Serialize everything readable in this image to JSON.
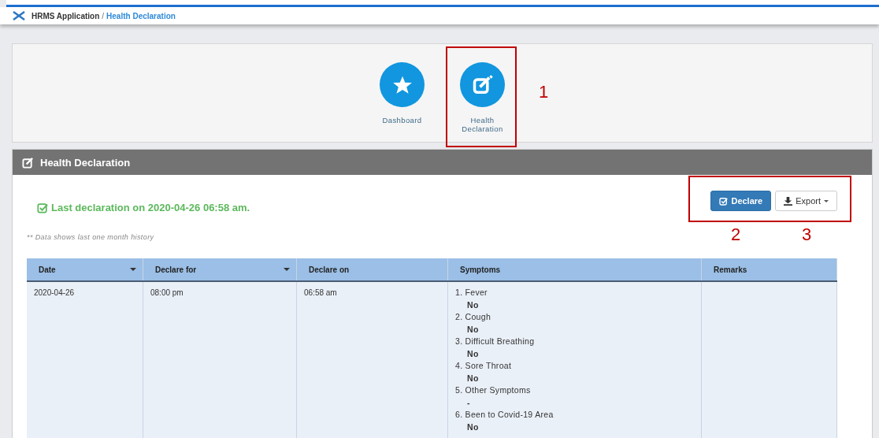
{
  "breadcrumb": {
    "items": [
      "HRMS Application",
      "Health Declaration"
    ],
    "separator": "/"
  },
  "nav": [
    {
      "label": "Dashboard"
    },
    {
      "label": "Health Declaration"
    }
  ],
  "panel": {
    "title": "Health Declaration",
    "status": "Last declaration on 2020-04-26 06:58 am.",
    "buttons": [
      {
        "label": "Declare",
        "kind": "primary"
      },
      {
        "label": "Export",
        "kind": "dropdown"
      }
    ],
    "note": "** Data shows last one month history",
    "table": {
      "columns": [
        {
          "label": "Date",
          "sortable": true
        },
        {
          "label": "Declare for",
          "sortable": true
        },
        {
          "label": "Declare on",
          "sortable": false
        },
        {
          "label": "Symptoms",
          "sortable": false
        },
        {
          "label": "Remarks",
          "sortable": false
        }
      ],
      "rows": [
        {
          "date": "2020-04-26",
          "declare_for": "08:00 pm",
          "declare_on": "06:58 am",
          "symptoms": [
            {
              "question": "1. Fever",
              "answer": "No"
            },
            {
              "question": "2. Cough",
              "answer": "No"
            },
            {
              "question": "3. Difficult Breathing",
              "answer": "No"
            },
            {
              "question": "4. Sore Throat",
              "answer": "No"
            },
            {
              "question": "5. Other Symptoms",
              "answer": "-"
            },
            {
              "question": "6. Been to Covid-19 Area",
              "answer": "No"
            }
          ]
        }
      ]
    }
  },
  "annotations": [
    {
      "label": "1"
    },
    {
      "label": "2"
    },
    {
      "label": "3"
    }
  ]
}
